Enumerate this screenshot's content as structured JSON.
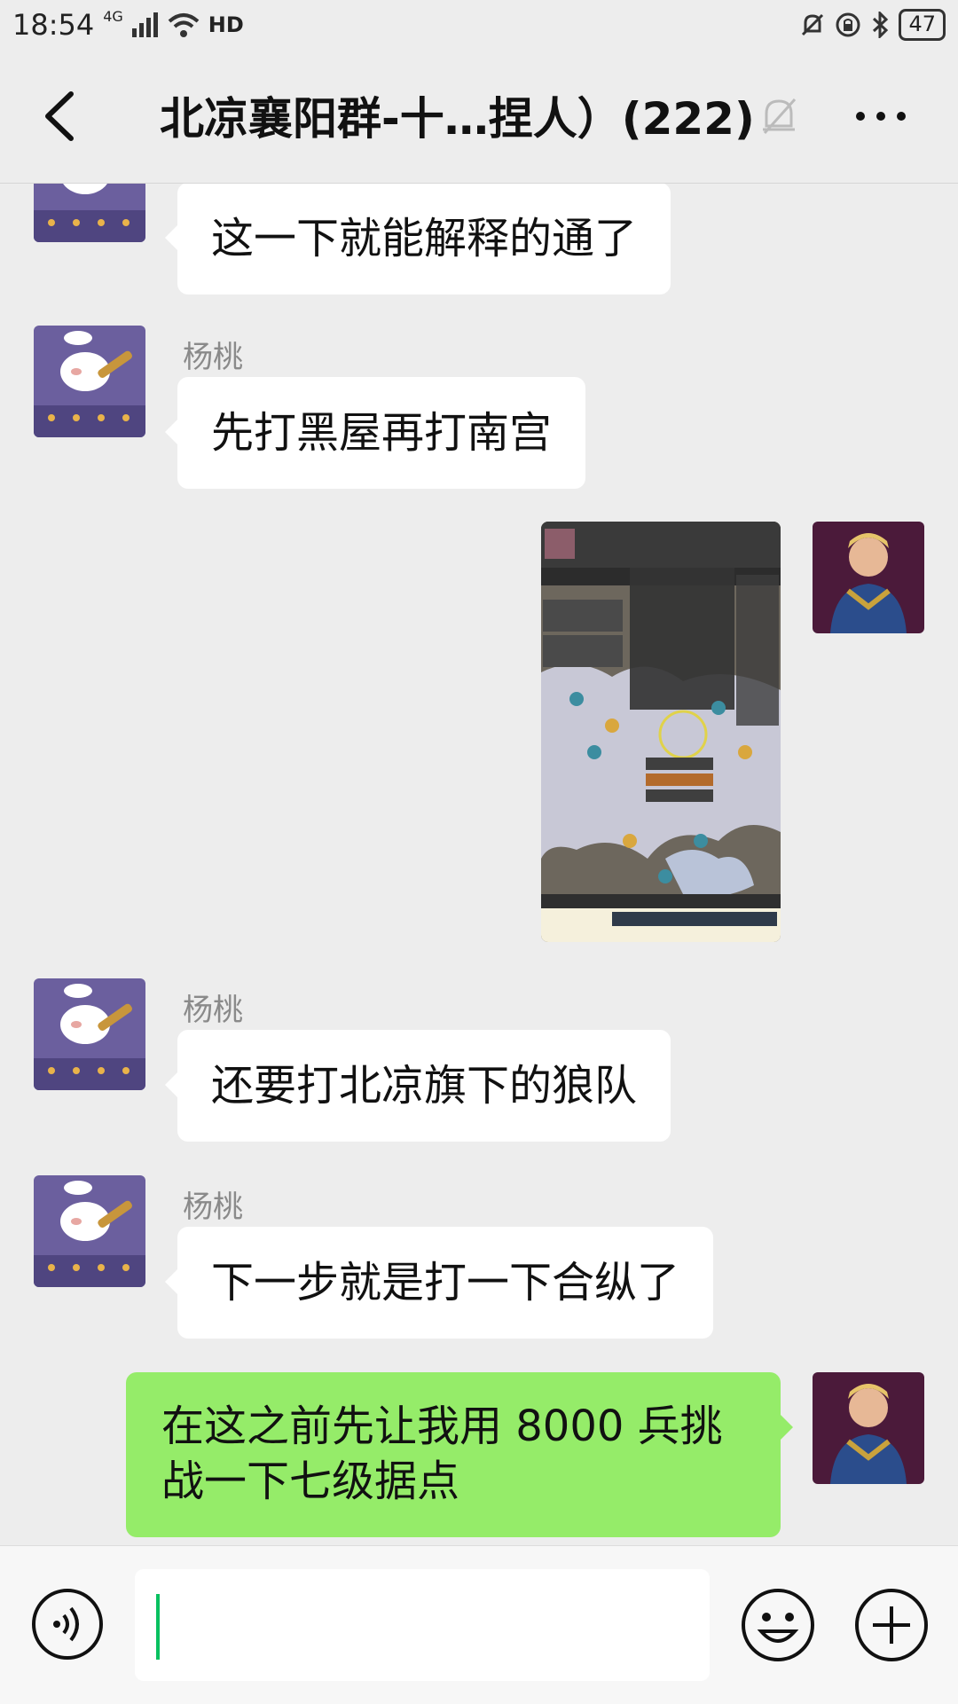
{
  "status_bar": {
    "time": "18:54",
    "network": "4G",
    "hd": "HD",
    "battery": "47"
  },
  "header": {
    "back_icon": "chevron-left-icon",
    "title": "北凉襄阳群-十…捏人）(222)",
    "mute_icon": "bell-muted-icon",
    "more_icon": "more-icon"
  },
  "messages": [
    {
      "side": "left",
      "sender": "",
      "text": "这一下就能解释的通了"
    },
    {
      "side": "left",
      "sender": "杨桃",
      "text": "先打黑屋再打南宫"
    },
    {
      "side": "right",
      "type": "image",
      "text": ""
    },
    {
      "side": "left",
      "sender": "杨桃",
      "text": "还要打北凉旗下的狼队"
    },
    {
      "side": "left",
      "sender": "杨桃",
      "text": "下一步就是打一下合纵了"
    },
    {
      "side": "right",
      "sender": "",
      "text": "在这之前先让我用 8000 兵挑战一下七级据点"
    }
  ],
  "input_bar": {
    "voice_icon": "voice-icon",
    "emoji_icon": "emoji-icon",
    "plus_icon": "plus-icon",
    "value": ""
  },
  "colors": {
    "chat_bg": "#ededed",
    "outgoing_bubble": "#95ec69",
    "incoming_bubble": "#ffffff",
    "caret": "#07c160"
  }
}
